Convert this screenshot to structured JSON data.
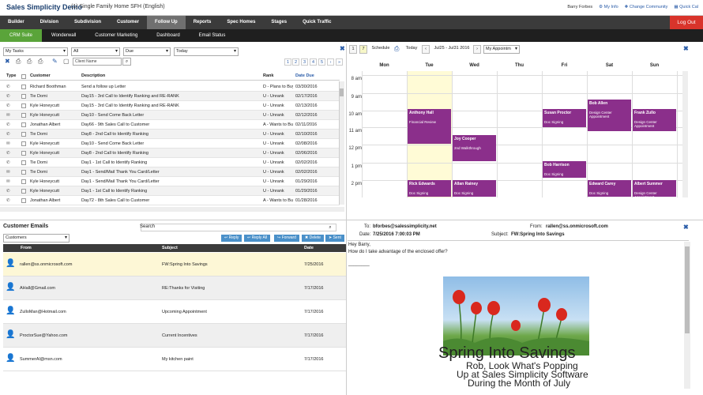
{
  "header": {
    "app_title": "Sales Simplicity Demo",
    "subtitle": "(1) Single Family Home SFH (English)",
    "user": "Barry Forbes",
    "my_info": "My Info",
    "change_community": "Change Community",
    "quick_cal": "Quick Cal"
  },
  "nav": {
    "items": [
      "Builder",
      "Division",
      "Subdivision",
      "Customer",
      "Follow Up",
      "Reports",
      "Spec Homes",
      "Stages",
      "Quick Traffic"
    ],
    "active": "Follow Up",
    "logout": "Log Out"
  },
  "subnav": {
    "items": [
      "CRM Suite",
      "Wonderwall",
      "Customer Marketing",
      "Dashboard",
      "Email Status"
    ],
    "active": "CRM Suite"
  },
  "tasks": {
    "filter_tasks": "My Tasks",
    "filter_all": "All",
    "filter_due": "Due",
    "filter_today": "Today",
    "client_placeholder": "Client Name",
    "pages": [
      "1",
      "2",
      "3",
      "4",
      "5"
    ],
    "columns": [
      "Type",
      "Customer",
      "Description",
      "Rank",
      "Date Due"
    ],
    "rows": [
      {
        "icon": "phone",
        "customer": "Richard Boothman",
        "desc": "Send a follow up Letter",
        "rank": "D - Plans to Buy",
        "date": "03/30/2016"
      },
      {
        "icon": "phone",
        "customer": "Tie Domi",
        "desc": "Day15 - 3rd Call to Identify Ranking and RE-RANK",
        "rank": "U - Unrank",
        "date": "02/17/2016"
      },
      {
        "icon": "phone",
        "customer": "Kyle Honeycutt",
        "desc": "Day15 - 3rd Call to Identify Ranking and RE-RANK",
        "rank": "U - Unrank",
        "date": "02/13/2016"
      },
      {
        "icon": "letter",
        "customer": "Kyle Honeycutt",
        "desc": "Day10 - Send Come Back Letter",
        "rank": "U - Unrank",
        "date": "02/12/2016"
      },
      {
        "icon": "phone",
        "customer": "Jonathan Albert",
        "desc": "Day66 - 9th Sales Call to Customer",
        "rank": "A - Wants to Buy",
        "date": "02/11/2016"
      },
      {
        "icon": "phone",
        "customer": "Tie Domi",
        "desc": "Day8 - 2nd Call to Identify Ranking",
        "rank": "U - Unrank",
        "date": "02/10/2016"
      },
      {
        "icon": "letter",
        "customer": "Kyle Honeycutt",
        "desc": "Day10 - Send Come Back Letter",
        "rank": "U - Unrank",
        "date": "02/08/2016"
      },
      {
        "icon": "phone",
        "customer": "Kyle Honeycutt",
        "desc": "Day8 - 2nd Call to Identify Ranking",
        "rank": "U - Unrank",
        "date": "02/06/2016"
      },
      {
        "icon": "phone",
        "customer": "Tie Domi",
        "desc": "Day1 - 1st Call to Identify Ranking",
        "rank": "U - Unrank",
        "date": "02/02/2016"
      },
      {
        "icon": "letter",
        "customer": "Tie Domi",
        "desc": "Day1 - Send/Mail Thank You Card/Letter",
        "rank": "U - Unrank",
        "date": "02/02/2016"
      },
      {
        "icon": "letter",
        "customer": "Kyle Honeycutt",
        "desc": "Day1 - Send/Mail Thank You Card/Letter",
        "rank": "U - Unrank",
        "date": "01/29/2016"
      },
      {
        "icon": "phone",
        "customer": "Kyle Honeycutt",
        "desc": "Day1 - 1st Call to Identify Ranking",
        "rank": "U - Unrank",
        "date": "01/29/2016"
      },
      {
        "icon": "phone",
        "customer": "Jonathan Albert",
        "desc": "Day72 - 8th Sales Call to Customer",
        "rank": "A - Wants to Buy",
        "date": "01/28/2016"
      }
    ]
  },
  "calendar": {
    "today": "Today",
    "schedule": "Schedule",
    "range": "Jul25 - Jul31 2016",
    "view": "My Appointm",
    "nums": [
      "1",
      "7"
    ],
    "days": [
      "Mon",
      "Tue",
      "Wed",
      "Thu",
      "Fri",
      "Sat",
      "Sun"
    ],
    "hours": [
      "8 am",
      "9 am",
      "10 am",
      "11 am",
      "12 pm",
      "1 pm",
      "2 pm"
    ],
    "events": [
      {
        "title": "Anthony Hall",
        "sub": "Financial Review"
      },
      {
        "title": "Joy Cooper",
        "sub": "2nd Walkthrough"
      },
      {
        "title": "Susan Proctor",
        "sub": "Doc Signing"
      },
      {
        "title": "Bob Allen",
        "sub": "Design Center Appointment"
      },
      {
        "title": "Frank Zullo",
        "sub": "Design Center Appointment"
      },
      {
        "title": "Bob Harrison",
        "sub": "Doc Signing"
      },
      {
        "title": "Rick Edwards",
        "sub": "Doc Signing"
      },
      {
        "title": "Allan Rainey",
        "sub": "Doc Signing"
      },
      {
        "title": "Edward Carey",
        "sub": "Doc Signing"
      },
      {
        "title": "Albert Summer",
        "sub": "Design Center Appointment"
      }
    ]
  },
  "emails": {
    "title": "Customer Emails",
    "search_label": "Search",
    "folder": "Customers",
    "buttons": [
      "Reply",
      "Reply All",
      "Forward",
      "Delete",
      "Sent"
    ],
    "columns": [
      "From",
      "Subject",
      "Date"
    ],
    "rows": [
      {
        "from": "rallen@ss.onmicrosoft.com",
        "subject": "FW:Spring Into Savings",
        "date": "7/25/2016"
      },
      {
        "from": "AHall@Gmail.com",
        "subject": "RE:Thanks for Visiting",
        "date": "7/17/2016"
      },
      {
        "from": "ZulloMan@Hotmail.com",
        "subject": "Upcoming Appointment",
        "date": "7/17/2016"
      },
      {
        "from": "ProctorSue@Yahoo.com",
        "subject": "Current Incentives",
        "date": "7/17/2016"
      },
      {
        "from": "SummerAl@msn.com",
        "subject": "My kitchen paint",
        "date": "7/17/2016"
      }
    ]
  },
  "preview": {
    "to_label": "To:",
    "to": "bforbes@salessimplicity.net",
    "from_label": "From:",
    "from": "rallen@ss.onmicrosoft.com",
    "date_label": "Date:",
    "date": "7/25/2016 7:00:03 PM",
    "subject_label": "Subject:",
    "subject": "FW:Spring Into Savings",
    "greeting": "Hey Barry,",
    "body": "How do I take advantage of the enclosed offer?",
    "divider": "________",
    "headline": "Spring Into Savings",
    "line1": "Rob, Look What's Popping",
    "line2": "Up at Sales Simplicity Software",
    "line3": "During the Month of July"
  }
}
